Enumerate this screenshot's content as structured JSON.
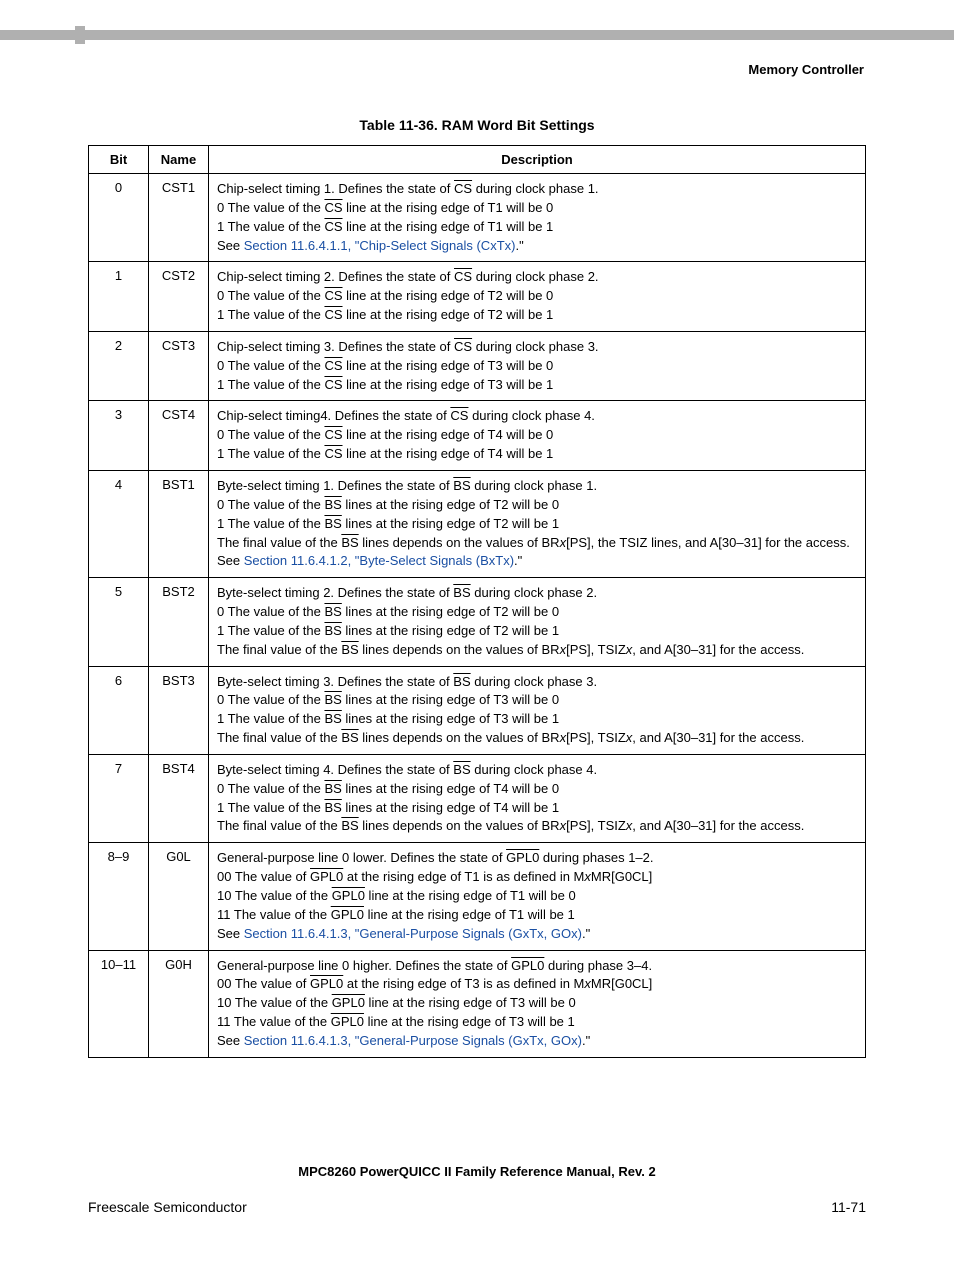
{
  "header": {
    "section": "Memory Controller"
  },
  "table": {
    "caption": "Table 11-36. RAM Word Bit Settings",
    "headers": {
      "bit": "Bit",
      "name": "Name",
      "desc": "Description"
    },
    "rows": [
      {
        "bit": "0",
        "name": "CST1",
        "line1_a": "Chip-select timing 1. Defines the state of ",
        "line1_sig": "CS",
        "line1_b": " during clock phase 1.",
        "opt0_a": "0  The value of the ",
        "opt0_sig": "CS",
        "opt0_b": " line at the rising edge of T1 will be 0",
        "opt1_a": "1  The value of the ",
        "opt1_sig": "CS",
        "opt1_b": " line at the rising edge of T1 will be 1",
        "see_a": "See ",
        "see_link": "Section 11.6.4.1.1, \"Chip-Select Signals (CxTx)",
        "see_b": ".\""
      },
      {
        "bit": "1",
        "name": "CST2",
        "line1_a": "Chip-select timing 2. Defines the state of ",
        "line1_sig": "CS",
        "line1_b": " during clock phase 2.",
        "opt0_a": "0  The value of the ",
        "opt0_sig": "CS",
        "opt0_b": " line at the rising edge of T2 will be 0",
        "opt1_a": "1  The value of the ",
        "opt1_sig": "CS",
        "opt1_b": " line at the rising edge of T2 will be 1"
      },
      {
        "bit": "2",
        "name": "CST3",
        "line1_a": "Chip-select timing 3. Defines the state of ",
        "line1_sig": "CS",
        "line1_b": " during clock phase 3.",
        "opt0_a": "0  The value of the ",
        "opt0_sig": "CS",
        "opt0_b": " line at the rising edge of T3 will be 0",
        "opt1_a": "1  The value of the ",
        "opt1_sig": "CS",
        "opt1_b": " line at the rising edge of T3 will be 1"
      },
      {
        "bit": "3",
        "name": "CST4",
        "line1_a": "Chip-select timing4. Defines the state of ",
        "line1_sig": "CS",
        "line1_b": " during clock phase 4.",
        "opt0_a": "0  The value of the ",
        "opt0_sig": "CS",
        "opt0_b": " line at the rising edge of T4 will be 0",
        "opt1_a": "1  The value of the ",
        "opt1_sig": "CS",
        "opt1_b": " line at the rising edge of T4 will be 1"
      },
      {
        "bit": "4",
        "name": "BST1",
        "line1_a": "Byte-select timing 1. Defines the state of ",
        "line1_sig": "BS",
        "line1_b": " during clock phase 1.",
        "opt0_a": "0  The value of the ",
        "opt0_sig": "BS",
        "opt0_b": " lines at the rising edge of T2 will be 0",
        "opt1_a": "1  The value of the ",
        "opt1_sig": "BS",
        "opt1_b": " lines at the rising edge of T2 will be 1",
        "tail_a": "The final value of the ",
        "tail_sig": "BS",
        "tail_b": " lines depends on the values of BR",
        "tail_ix": "x",
        "tail_c": "[PS], the TSIZ lines, and A[30–31] for the access. See ",
        "tail_link": "Section 11.6.4.1.2, \"Byte-Select Signals (BxTx)",
        "tail_d": ".\""
      },
      {
        "bit": "5",
        "name": "BST2",
        "line1_a": "Byte-select timing 2. Defines the state of ",
        "line1_sig": "BS",
        "line1_b": " during clock phase 2.",
        "opt0_a": "0  The value of the ",
        "opt0_sig": "BS",
        "opt0_b": " lines at the rising edge of T2 will be 0",
        "opt1_a": "1  The value of the ",
        "opt1_sig": "BS",
        "opt1_b": " lines at the rising edge of T2 will be 1",
        "tail_a": "The final value of the ",
        "tail_sig": "BS",
        "tail_b": " lines depends on the values of BR",
        "tail_ix": "x",
        "tail_c": "[PS], TSIZ",
        "tail_ix2": "x",
        "tail_e": ", and A[30–31] for the access."
      },
      {
        "bit": "6",
        "name": "BST3",
        "line1_a": "Byte-select timing 3. Defines the state of ",
        "line1_sig": "BS",
        "line1_b": " during clock phase 3.",
        "opt0_a": "0  The value of the ",
        "opt0_sig": "BS",
        "opt0_b": " lines at the rising edge of T3 will be 0",
        "opt1_a": "1  The value of the ",
        "opt1_sig": "BS",
        "opt1_b": " lines at the rising edge of T3 will be 1",
        "tail_a": "The final value of the ",
        "tail_sig": "BS",
        "tail_b": " lines depends on the values of BR",
        "tail_ix": "x",
        "tail_c": "[PS], TSIZ",
        "tail_ix2": "x",
        "tail_e": ", and A[30–31] for the access."
      },
      {
        "bit": "7",
        "name": "BST4",
        "line1_a": "Byte-select timing 4. Defines the state of ",
        "line1_sig": "BS",
        "line1_b": " during clock phase 4.",
        "opt0_a": "0  The value of the ",
        "opt0_sig": "BS",
        "opt0_b": " lines at the rising edge of T4 will be 0",
        "opt1_a": "1  The value of the ",
        "opt1_sig": "BS",
        "opt1_b": " lines at the rising edge of T4 will be 1",
        "tail_a": "The final value of the ",
        "tail_sig": "BS",
        "tail_b": " lines depends on the values of BR",
        "tail_ix": "x",
        "tail_c": "[PS], TSIZ",
        "tail_ix2": "x",
        "tail_e": ", and A[30–31] for the access."
      },
      {
        "bit": "8–9",
        "name": "G0L",
        "line1_a": "General-purpose line 0 lower. Defines the state of ",
        "line1_sig": "GPL0",
        "line1_b": " during phases 1–2.",
        "g00_a": "00  The value of ",
        "g00_sig": "GPL0",
        "g00_b": " at the rising edge of T1 is as defined in M",
        "g00_ix": "x",
        "g00_c": "MR[G0CL]",
        "g10_a": "10  The value of the ",
        "g10_sig": "GPL0",
        "g10_b": " line at the rising edge of T1 will be 0",
        "g11_a": "11  The value of the ",
        "g11_sig": "GPL0",
        "g11_b": " line at the rising edge of T1 will be 1",
        "see_a": "See ",
        "see_link": "Section 11.6.4.1.3, \"General-Purpose Signals (GxTx, GOx)",
        "see_b": ".\""
      },
      {
        "bit": "10–11",
        "name": "G0H",
        "line1_a": "General-purpose line 0 higher. Defines the state of ",
        "line1_sig": "GPL0",
        "line1_b": " during phase 3–4.",
        "g00_a": "00 The value of ",
        "g00_sig": "GPL0",
        "g00_b": " at the rising edge of T3 is as defined in M",
        "g00_ix": "x",
        "g00_c": "MR[G0CL]",
        "g10_a": "10  The value of the ",
        "g10_sig": "GPL0",
        "g10_b": " line at the rising edge of T3 will be 0",
        "g11_a": "11  The value of the ",
        "g11_sig": "GPL0",
        "g11_b": " line at the rising edge of T3 will be 1",
        "see_a": "See ",
        "see_link": "Section 11.6.4.1.3, \"General-Purpose Signals (GxTx, GOx)",
        "see_b": ".\""
      }
    ]
  },
  "footer": {
    "manual": "MPC8260 PowerQUICC II Family Reference Manual, Rev. 2",
    "vendor": "Freescale Semiconductor",
    "page": "11-71"
  }
}
